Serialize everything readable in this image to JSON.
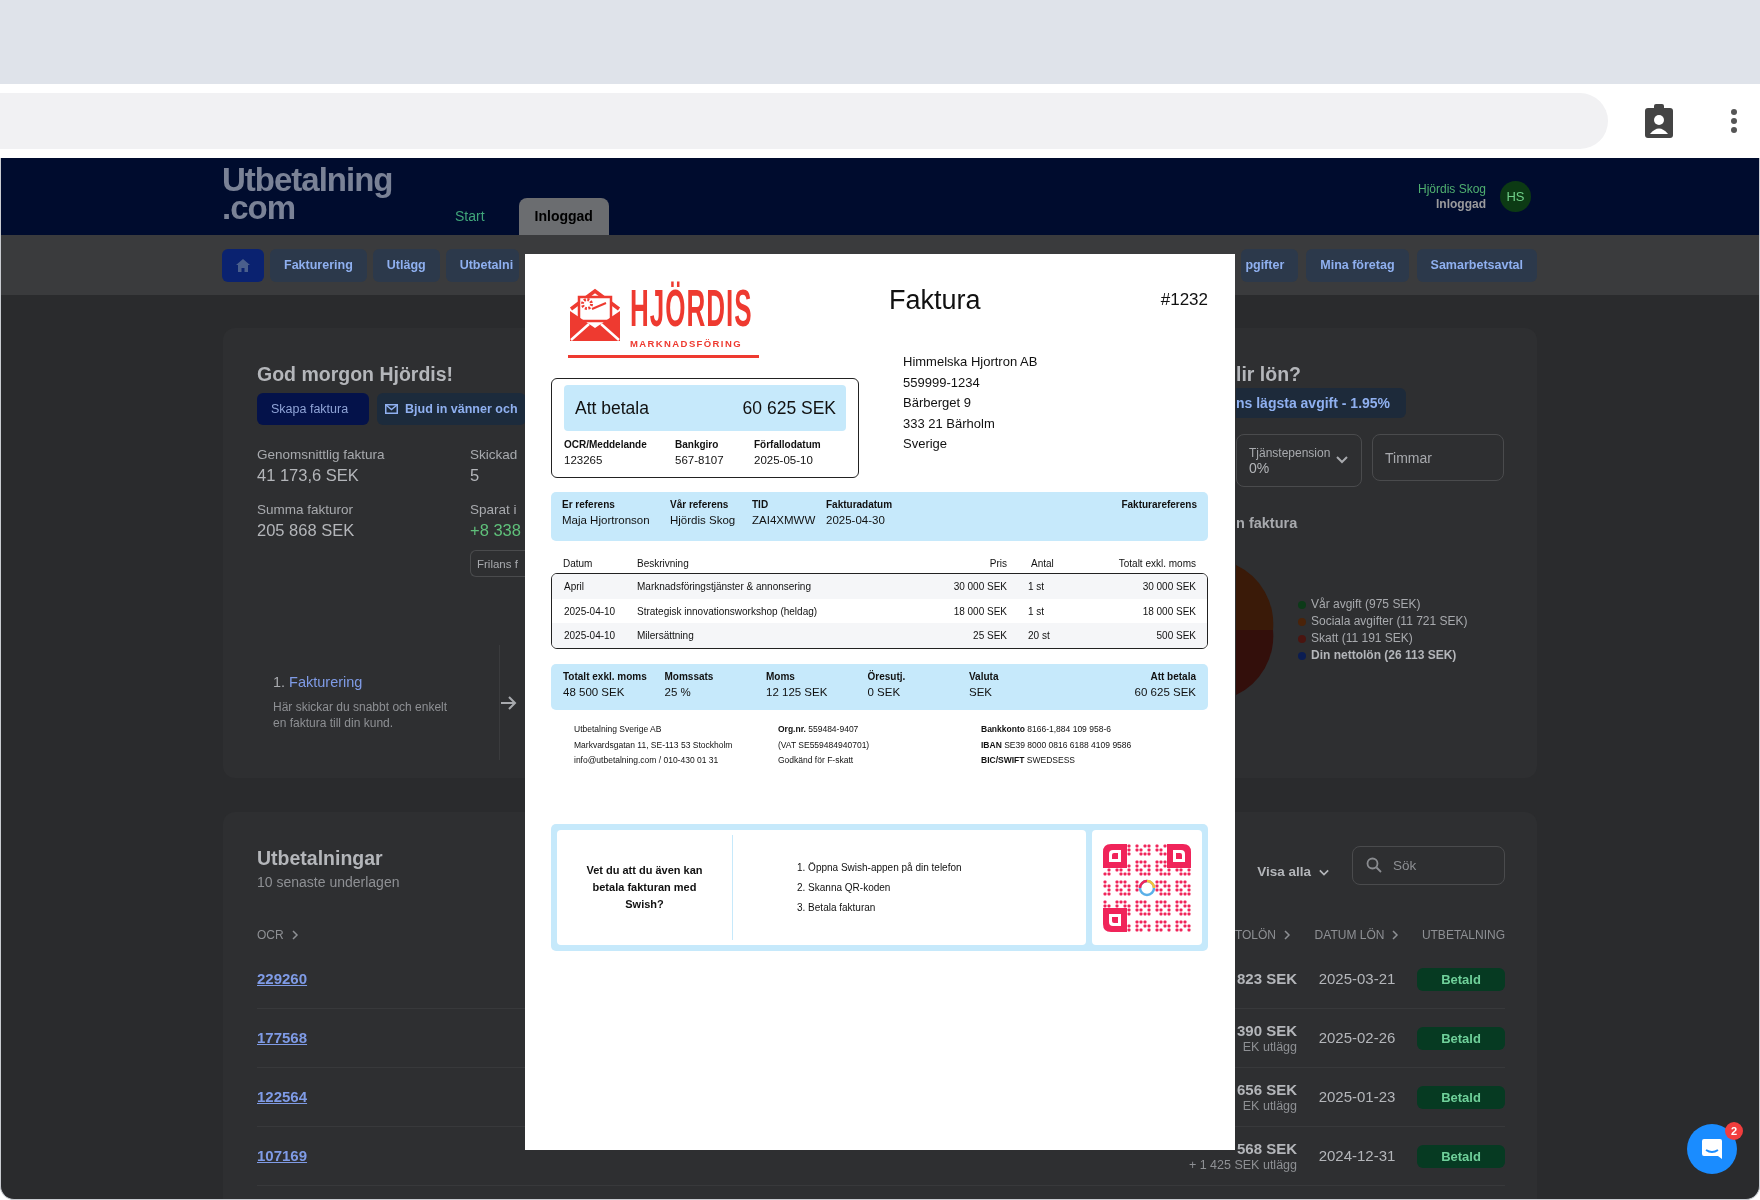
{
  "header": {
    "logo": [
      "Utbetalning",
      ".com"
    ],
    "tabs": [
      {
        "label": "Start",
        "selected": false
      },
      {
        "label": "Inloggad",
        "selected": true
      }
    ],
    "user": {
      "name": "Hjördis Skog",
      "status": "Inloggad",
      "initials": "HS"
    }
  },
  "nav": {
    "left": [
      {
        "kind": "home"
      },
      {
        "kind": "link",
        "label": "Fakturering"
      },
      {
        "kind": "link",
        "label": "Utlägg"
      },
      {
        "kind": "cut",
        "label": "Utbetalni"
      }
    ],
    "right": [
      {
        "kind": "cut",
        "label": "pgifter"
      },
      {
        "kind": "link",
        "label": "Mina företag"
      },
      {
        "kind": "link",
        "label": "Samarbetsavtal"
      }
    ]
  },
  "welcome": {
    "title": "God morgon Hjördis!",
    "buttons": [
      {
        "kind": "primary",
        "label": "Skapa faktura"
      },
      {
        "kind": "mail",
        "label": "Bjud in vänner och"
      }
    ],
    "stats": [
      {
        "label": "Genomsnittlig faktura",
        "value": "41 173,6 SEK",
        "positive": false
      },
      {
        "label": "Skickad",
        "value": "5",
        "positive": false
      },
      {
        "label": "Summa fakturor",
        "value": "205 868 SEK",
        "positive": false
      },
      {
        "label": "Sparat i",
        "value": "+8 338",
        "positive": true
      }
    ],
    "chip": "Frilans f",
    "step": {
      "number": "1.",
      "title": "Fakturering",
      "text": "Här skickar du snabbt och enkelt en faktura till din kund."
    }
  },
  "salary": {
    "title": "lir lön?",
    "badge": "ns lägsta avgift - 1.95%",
    "fields": [
      {
        "kind": "select",
        "label": "Tjänstepension",
        "value": "0%"
      },
      {
        "kind": "input",
        "placeholder": "Timmar"
      }
    ],
    "subtitle": "n faktura",
    "legend": [
      {
        "label": "Vår avgift (975 SEK)",
        "color": "#0c3a18",
        "emphasis": false
      },
      {
        "label": "Sociala avgifter (11 721 SEK)",
        "color": "#4a2309",
        "emphasis": false
      },
      {
        "label": "Skatt (11 191 SEK)",
        "color": "#4a1510",
        "emphasis": false
      },
      {
        "label": "Din nettolön (26 113 SEK)",
        "color": "#0b1d52",
        "emphasis": true
      }
    ]
  },
  "payouts": {
    "title": "Utbetalningar",
    "subtitle": "10 senaste underlagen",
    "filter": "Visa alla",
    "search": {
      "placeholder": "Sök"
    },
    "columns": [
      {
        "label": "OCR",
        "sortable": true
      },
      {
        "label": "TOLÖN",
        "sortable": true
      },
      {
        "label": "DATUM LÖN",
        "sortable": true
      },
      {
        "label": "UTBETALNING",
        "sortable": false
      }
    ],
    "rows": [
      {
        "ocr": "229260",
        "amount": "823 SEK",
        "date": "2025-03-21",
        "status": "Betald"
      },
      {
        "ocr": "177568",
        "amount": "390 SEK",
        "extra": "EK utlägg",
        "date": "2025-02-26",
        "status": "Betald"
      },
      {
        "ocr": "122564",
        "amount": "656 SEK",
        "extra": "EK utlägg",
        "date": "2025-01-23",
        "status": "Betald"
      },
      {
        "ocr": "107169",
        "amount": "568 SEK",
        "extra": "+ 1 425 SEK utlägg",
        "date": "2024-12-31",
        "status": "Betald"
      }
    ]
  },
  "chat": {
    "badge": "2"
  },
  "invoice": {
    "logo": {
      "name": "HJÖRDIS",
      "tagline": "MARKNADSFÖRING"
    },
    "title": "Faktura",
    "number": "#1232",
    "payment": {
      "label": "Att betala",
      "amount": "60 625 SEK",
      "fields": [
        {
          "label": "OCR/Meddelande",
          "value": "123265"
        },
        {
          "label": "Bankgiro",
          "value": "567-8107"
        },
        {
          "label": "Förfallodatum",
          "value": "2025-05-10"
        }
      ]
    },
    "recipient": [
      "Himmelska Hjortron AB",
      "559999-1234",
      "Bärberget 9",
      "333 21 Bärholm",
      "Sverige"
    ],
    "references": [
      {
        "label": "Er referens",
        "value": "Maja Hjortronson"
      },
      {
        "label": "Vår referens",
        "value": "Hjördis Skog"
      },
      {
        "label": "TID",
        "value": "ZAI4XMWW"
      },
      {
        "label": "Fakturadatum",
        "value": "2025-04-30"
      },
      {
        "label": "Fakturareferens"
      }
    ],
    "table": {
      "columns": [
        "Datum",
        "Beskrivning",
        "Pris",
        "Antal",
        "Totalt exkl. moms"
      ],
      "rows": [
        [
          "April",
          "Marknadsföringstjänster & annonsering",
          "30 000 SEK",
          "1 st",
          "30 000 SEK"
        ],
        [
          "2025-04-10",
          "Strategisk innovationsworkshop (heldag)",
          "18 000 SEK",
          "1 st",
          "18 000 SEK"
        ],
        [
          "2025-04-10",
          "Milersättning",
          "25 SEK",
          "20 st",
          "500 SEK"
        ]
      ]
    },
    "totals": [
      {
        "label": "Totalt exkl. moms",
        "value": "48 500 SEK"
      },
      {
        "label": "Momssats",
        "value": "25 %"
      },
      {
        "label": "Moms",
        "value": "12 125 SEK"
      },
      {
        "label": "Öresutj.",
        "value": "0 SEK"
      },
      {
        "label": "Valuta",
        "value": "SEK"
      },
      {
        "label": "Att betala",
        "value": "60 625 SEK"
      }
    ],
    "footer": [
      [
        "Utbetalning Sverige AB",
        "Markvardsgatan 11, SE-113 53 Stockholm",
        "info@utbetalning.com / 010-430 01 31"
      ],
      [
        "**Org.nr.** 559484-9407",
        "(VAT SE559484940701)",
        "Godkänd för F-skatt"
      ],
      [
        "**Bankkonto** 8166-1,884 109 958-6",
        "**IBAN** SE39 8000 0816 6188 4109 9586",
        "**BIC/SWIFT** SWEDSESS"
      ]
    ],
    "swish": {
      "question": "Vet du att du även kan betala fakturan med Swish?",
      "steps": [
        "1. Öppna Swish-appen på din telefon",
        "2. Skanna QR-koden",
        "3. Betala fakturan"
      ]
    }
  }
}
